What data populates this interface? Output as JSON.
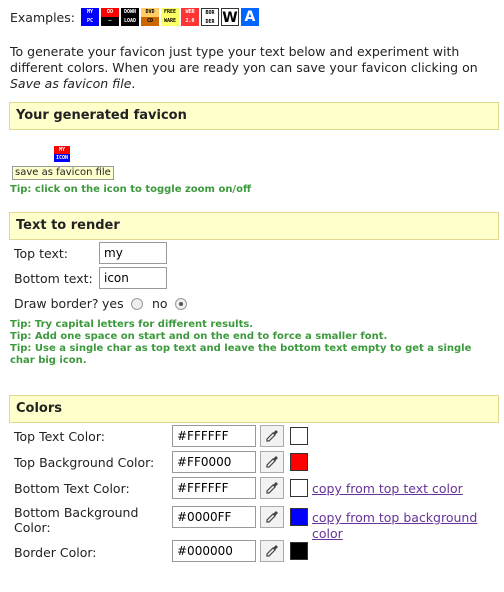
{
  "examples": {
    "label": "Examples:",
    "icons": [
      {
        "top": "MY",
        "bottom": "PC",
        "top_bg": "#0000ff",
        "bottom_bg": "#0000ff",
        "fg": "#ffffff"
      },
      {
        "top": "OO",
        "bottom": "—",
        "top_bg": "#ff0000",
        "bottom_bg": "#000000",
        "fg": "#ffffff"
      },
      {
        "top": "DOWN",
        "bottom": "LOAD",
        "top_bg": "#000000",
        "bottom_bg": "#000000",
        "fg": "#ffffff"
      },
      {
        "top": "DVD",
        "bottom": "CD",
        "top_bg": "#ffcc66",
        "bottom_bg": "#cc6600",
        "fg": "#000000"
      },
      {
        "top": "FREE",
        "bottom": "WARE",
        "top_bg": "#ffff66",
        "bottom_bg": "#ffff66",
        "fg": "#000000"
      },
      {
        "top": "WEB",
        "bottom": "2.0",
        "top_bg": "#ff3333",
        "bottom_bg": "#ff3333",
        "fg": "#ffffff"
      },
      {
        "top": "BOR",
        "bottom": "DER",
        "top_bg": "#ffffff",
        "bottom_bg": "#ffffff",
        "fg": "#000000"
      }
    ],
    "big_w": "W",
    "big_a": "A"
  },
  "intro": {
    "text_1": "To generate your favicon just type your text below and experiment with different colors. When you are ready yon can save your favicon clicking on ",
    "text_link": "Save as favicon file",
    "text_2": "."
  },
  "generated": {
    "title": "Your generated favicon",
    "save_label": "save as favicon file",
    "tip": "Tip: click on the icon to toggle zoom on/off"
  },
  "text_section": {
    "title": "Text to render",
    "top_label": "Top text:",
    "top_value": "my",
    "bottom_label": "Bottom text:",
    "bottom_value": "icon",
    "border_label": "Draw border?",
    "yes_label": "yes",
    "no_label": "no",
    "tip_1": "Tip: Try capital letters for different results.",
    "tip_2": "Tip: Add one space on start and on the end to force a smaller font.",
    "tip_3": "Tip: Use a single char as top text and leave the bottom text empty to get a single char big icon."
  },
  "colors": {
    "title": "Colors",
    "rows": [
      {
        "label": "Top Text Color:",
        "value": "#FFFFFF",
        "swatch": "#FFFFFF",
        "link": ""
      },
      {
        "label": "Top Background Color:",
        "value": "#FF0000",
        "swatch": "#FF0000",
        "link": ""
      },
      {
        "label": "Bottom Text Color:",
        "value": "#FFFFFF",
        "swatch": "#FFFFFF",
        "link": "copy from top text color"
      },
      {
        "label": "Bottom Background Color:",
        "value": "#0000FF",
        "swatch": "#0000FF",
        "link": "copy from top background color"
      },
      {
        "label": "Border Color:",
        "value": "#000000",
        "swatch": "#000000",
        "link": ""
      }
    ]
  },
  "preview": {
    "top": "MY",
    "bottom": "ICON"
  }
}
